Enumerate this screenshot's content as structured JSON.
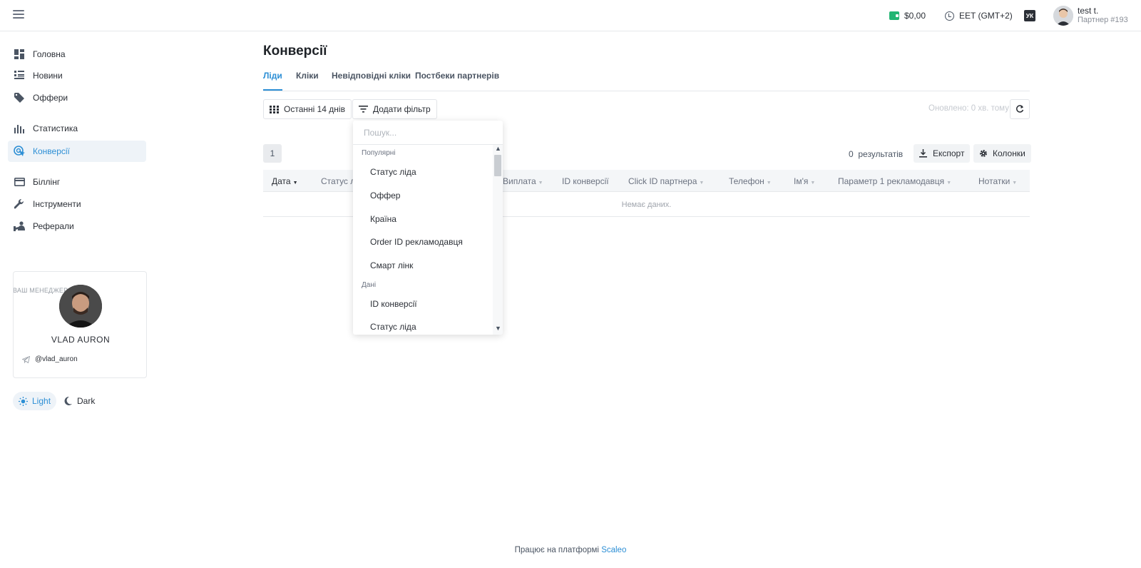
{
  "header": {
    "balance": "$0,00",
    "timezone": "EET (GMT+2)",
    "language": "УК",
    "user_name": "test t.",
    "user_sub": "Партнер #193"
  },
  "sidebar": {
    "items": [
      {
        "label": "Головна",
        "icon": "dashboard-icon"
      },
      {
        "label": "Новини",
        "icon": "news-icon"
      },
      {
        "label": "Оффери",
        "icon": "tag-icon"
      },
      {
        "label": "Статистика",
        "icon": "bar-chart-icon"
      },
      {
        "label": "Конверсії",
        "icon": "conversion-icon"
      },
      {
        "label": "Біллінг",
        "icon": "credit-card-icon"
      },
      {
        "label": "Інструменти",
        "icon": "wrench-icon"
      },
      {
        "label": "Реферали",
        "icon": "referral-icon"
      }
    ],
    "manager_label": "ВАШ МЕНЕДЖЕР",
    "manager_name": "VLAD AURON",
    "manager_telegram": "@vlad_auron",
    "theme_light": "Light",
    "theme_dark": "Dark"
  },
  "main": {
    "title": "Конверсії",
    "tabs": [
      "Ліди",
      "Кліки",
      "Невідповідні кліки",
      "Постбеки партнерів"
    ],
    "date_range": "Останні 14 днів",
    "add_filter": "Додати фільтр",
    "updated": "Оновлено: 0 хв. тому",
    "page": "1",
    "results_count": "0",
    "results_label": "результатів",
    "export": "Експорт",
    "columns": "Колонки",
    "table_headers": [
      "Дата",
      "Статус л",
      "Виплата",
      "ID конверсії",
      "Click ID партнера",
      "Телефон",
      "Ім'я",
      "Параметр 1 рекламодавця",
      "Нотатки"
    ],
    "empty": "Немає даних."
  },
  "dropdown": {
    "search_placeholder": "Пошук...",
    "group_popular": "Популярні",
    "popular_options": [
      "Статус ліда",
      "Оффер",
      "Країна",
      "Order ID рекламодавця",
      "Смарт лінк"
    ],
    "group_data": "Дані",
    "data_options": [
      "ID конверсії",
      "Статус ліда"
    ]
  },
  "footer": {
    "text": "Працює на платформі",
    "link": "Scaleo"
  },
  "colors": {
    "accent": "#2d8fd5",
    "wallet": "#22b573"
  }
}
